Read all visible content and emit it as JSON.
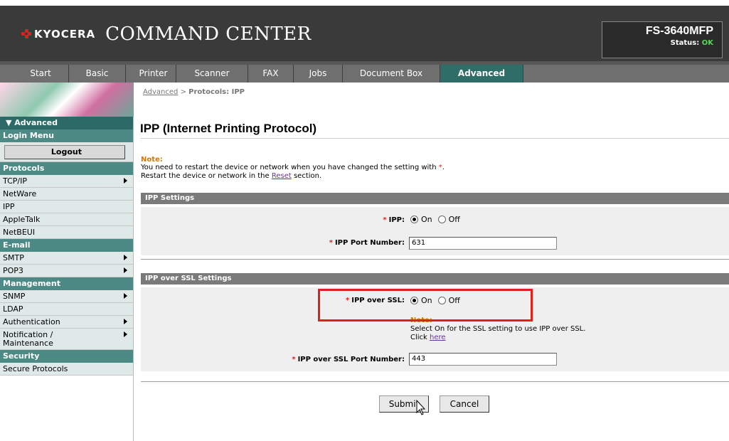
{
  "header": {
    "brand": "KYOCERA",
    "app_title": "COMMAND CENTER",
    "model": "FS-3640MFP",
    "status_label": "Status:",
    "status_value": "OK",
    "status_color": "#58d858"
  },
  "nav": {
    "items": [
      {
        "label": "Start"
      },
      {
        "label": "Basic"
      },
      {
        "label": "Printer"
      },
      {
        "label": "Scanner"
      },
      {
        "label": "FAX"
      },
      {
        "label": "Jobs"
      },
      {
        "label": "Document Box"
      },
      {
        "label": "Advanced"
      }
    ],
    "active": "Advanced"
  },
  "sidebar": {
    "advanced_label": "▼ Advanced",
    "login_menu": "Login Menu",
    "logout_button": "Logout",
    "protocols_head": "Protocols",
    "protocols": [
      "TCP/IP",
      "NetWare",
      "IPP",
      "AppleTalk",
      "NetBEUI"
    ],
    "email_head": "E-mail",
    "email": [
      "SMTP",
      "POP3"
    ],
    "management_head": "Management",
    "management": [
      "SNMP",
      "LDAP",
      "Authentication",
      "Notification / Maintenance"
    ],
    "security_head": "Security",
    "security": [
      "Secure Protocols"
    ]
  },
  "breadcrumb": {
    "link": "Advanced",
    "sep": ">",
    "current": "Protocols: IPP"
  },
  "page_title": "IPP (Internet Printing Protocol)",
  "note": {
    "label": "Note:",
    "line1": "You need to restart the device or network when you have changed the setting with",
    "star": "*",
    "line1_end": ".",
    "line2_pre": "Restart the device or network in the",
    "line2_link": "Reset",
    "line2_post": "section."
  },
  "ipp_section": {
    "title": "IPP Settings",
    "ipp_label": "IPP:",
    "ipp_on": "On",
    "ipp_off": "Off",
    "ipp_value": "On",
    "port_label": "IPP Port Number:",
    "port_value": "631"
  },
  "ssl_section": {
    "title": "IPP over SSL Settings",
    "ssl_label": "IPP over SSL:",
    "ssl_on": "On",
    "ssl_off": "Off",
    "ssl_value": "On",
    "note_label": "Note:",
    "note_text": "Select On for the SSL setting to use IPP over SSL.",
    "click_text": "Click",
    "click_link": "here",
    "port_label": "IPP over SSL Port Number:",
    "port_value": "443"
  },
  "buttons": {
    "submit": "Submit",
    "cancel": "Cancel"
  }
}
